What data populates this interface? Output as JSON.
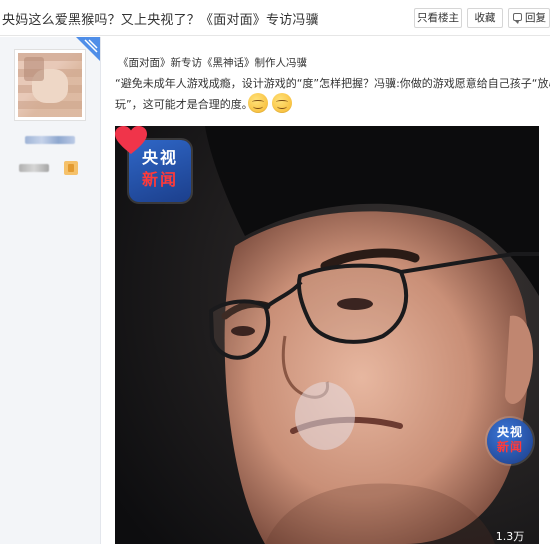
{
  "header": {
    "title": "央妈这么爱黑猴吗？又上央视了？《面对面》专访冯骥",
    "only_author": "只看楼主",
    "favorite": "收藏",
    "reply": "回复"
  },
  "post": {
    "meta": "《面对面》新专访《黑神话》制作人冯骥",
    "line1": "“避免未成年人游戏成瘾，设计游戏的“度”怎样把握？冯骥:你做的游戏愿意给自己孩子“放心",
    "line2": "玩”，这可能才是合理的度。”",
    "emojis": [
      "smile-icon",
      "smile-icon"
    ]
  },
  "video": {
    "logo_top_line1": "央视",
    "logo_top_line2": "新闻",
    "logo_bottom_line1": "央视",
    "logo_bottom_line2": "新闻",
    "likes": "1.3万",
    "heart_color": "#f0344a"
  }
}
